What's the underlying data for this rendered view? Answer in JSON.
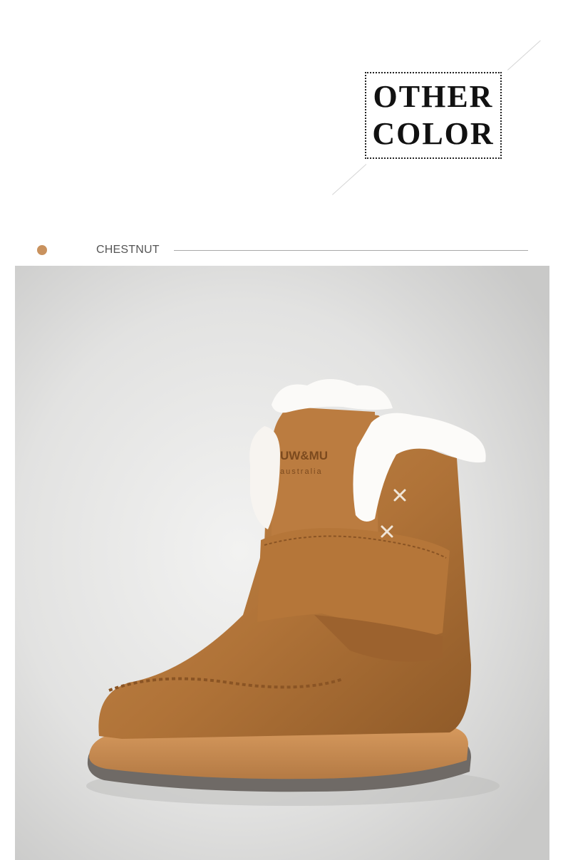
{
  "header": {
    "title_line_1": "OTHER",
    "title_line_2": "COLOR"
  },
  "color_option": {
    "name": "CHESTNUT",
    "swatch_color": "#c9925e"
  },
  "product_photo": {
    "brand_logo_text": "UW&MU",
    "brand_logo_subtext": "australia"
  }
}
